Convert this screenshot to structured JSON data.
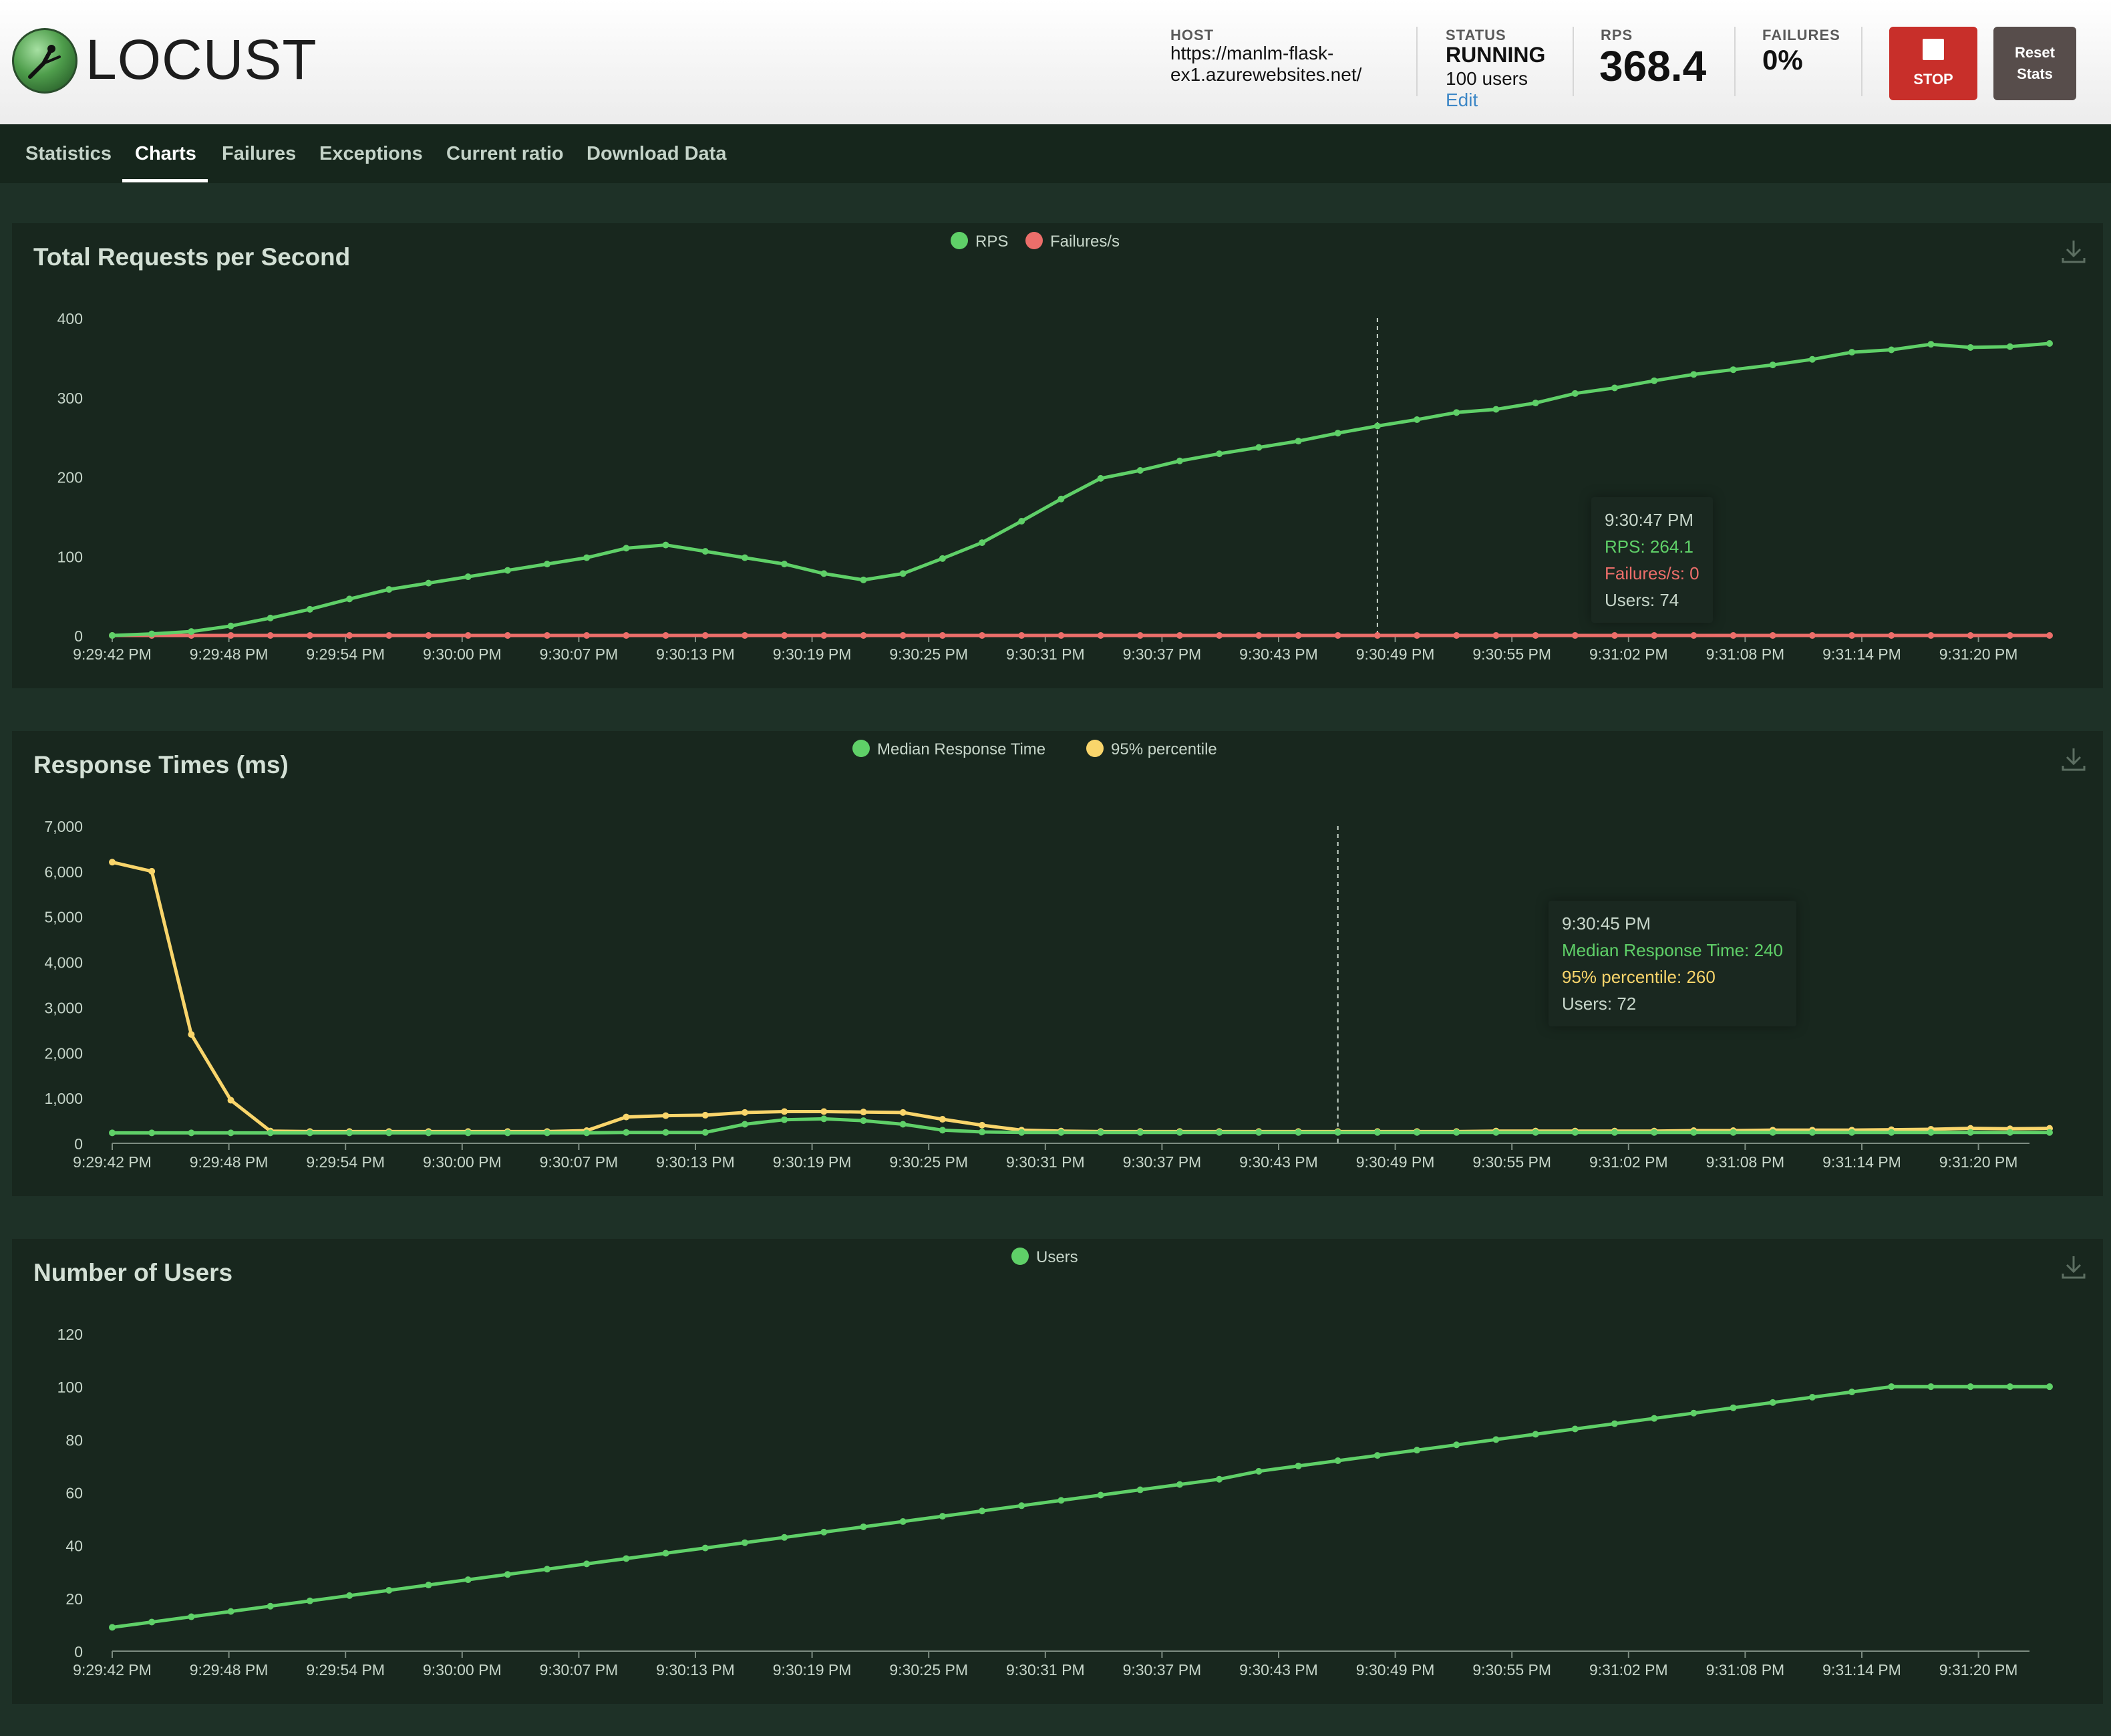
{
  "header": {
    "logo_text": "LOCUST",
    "host_label": "HOST",
    "host_line1": "https://manlm-flask-",
    "host_line2": "ex1.azurewebsites.net/",
    "status_label": "STATUS",
    "status_value": "RUNNING",
    "status_users": "100 users",
    "edit_label": "Edit",
    "rps_label": "RPS",
    "rps_value": "368.4",
    "failures_label": "FAILURES",
    "failures_value": "0%",
    "stop_label": "STOP",
    "reset_line1": "Reset",
    "reset_line2": "Stats"
  },
  "tabs": [
    "Statistics",
    "Charts",
    "Failures",
    "Exceptions",
    "Current ratio",
    "Download Data"
  ],
  "active_tab": "Charts",
  "colors": {
    "green": "#5fd068",
    "red": "#ec6e6a",
    "yellow": "#f9d56b",
    "panel": "#18271e",
    "axis_text": "#c7d6ca"
  },
  "charts": [
    {
      "id": "rps",
      "title": "Total Requests per Second",
      "legend": [
        {
          "name": "RPS",
          "color": "#5fd068"
        },
        {
          "name": "Failures/s",
          "color": "#ec6e6a"
        }
      ],
      "tooltip": {
        "time": "9:30:47 PM",
        "lines": [
          {
            "text": "RPS: 264.1",
            "color": "#5fd068"
          },
          {
            "text": "Failures/s: 0",
            "color": "#ec6e6a"
          },
          {
            "text": "Users: 74",
            "color": "#c7d6ca"
          }
        ]
      }
    },
    {
      "id": "response",
      "title": "Response Times (ms)",
      "legend": [
        {
          "name": "Median Response Time",
          "color": "#5fd068"
        },
        {
          "name": "95% percentile",
          "color": "#f9d56b"
        }
      ],
      "tooltip": {
        "time": "9:30:45 PM",
        "lines": [
          {
            "text": "Median Response Time: 240",
            "color": "#5fd068"
          },
          {
            "text": "95% percentile: 260",
            "color": "#f9d56b"
          },
          {
            "text": "Users: 72",
            "color": "#c7d6ca"
          }
        ]
      }
    },
    {
      "id": "users",
      "title": "Number of Users",
      "legend": [
        {
          "name": "Users",
          "color": "#5fd068"
        }
      ],
      "tooltip": null
    }
  ],
  "chart_data": [
    {
      "type": "line",
      "title": "Total Requests per Second",
      "x_ticks": [
        "9:29:42 PM",
        "9:29:48 PM",
        "9:29:54 PM",
        "9:30:00 PM",
        "9:30:07 PM",
        "9:30:13 PM",
        "9:30:19 PM",
        "9:30:25 PM",
        "9:30:31 PM",
        "9:30:37 PM",
        "9:30:43 PM",
        "9:30:49 PM",
        "9:30:55 PM",
        "9:31:02 PM",
        "9:31:08 PM",
        "9:31:14 PM",
        "9:31:20 PM"
      ],
      "y_ticks": [
        "0",
        "100",
        "200",
        "300",
        "400"
      ],
      "ylim": [
        0,
        400
      ],
      "n_points": 50,
      "hover_index": 32,
      "series": [
        {
          "name": "RPS",
          "color": "#5fd068",
          "values": [
            0,
            2,
            5,
            12,
            22,
            33,
            46,
            58,
            66,
            74,
            82,
            90,
            98,
            110,
            114,
            106,
            98,
            90,
            78,
            70,
            78,
            97,
            117,
            144,
            172,
            198,
            208,
            220,
            229,
            237,
            245,
            255,
            264,
            272,
            281,
            285,
            293,
            305,
            312,
            321,
            329,
            335,
            341,
            348,
            357,
            360,
            367,
            363,
            364,
            368
          ]
        },
        {
          "name": "Failures/s",
          "color": "#ec6e6a",
          "values": [
            0,
            0,
            0,
            0,
            0,
            0,
            0,
            0,
            0,
            0,
            0,
            0,
            0,
            0,
            0,
            0,
            0,
            0,
            0,
            0,
            0,
            0,
            0,
            0,
            0,
            0,
            0,
            0,
            0,
            0,
            0,
            0,
            0,
            0,
            0,
            0,
            0,
            0,
            0,
            0,
            0,
            0,
            0,
            0,
            0,
            0,
            0,
            0,
            0,
            0
          ]
        }
      ]
    },
    {
      "type": "line",
      "title": "Response Times (ms)",
      "x_ticks": [
        "9:29:42 PM",
        "9:29:48 PM",
        "9:29:54 PM",
        "9:30:00 PM",
        "9:30:07 PM",
        "9:30:13 PM",
        "9:30:19 PM",
        "9:30:25 PM",
        "9:30:31 PM",
        "9:30:37 PM",
        "9:30:43 PM",
        "9:30:49 PM",
        "9:30:55 PM",
        "9:31:02 PM",
        "9:31:08 PM",
        "9:31:14 PM",
        "9:31:20 PM"
      ],
      "y_ticks": [
        "0",
        "1,000",
        "2,000",
        "3,000",
        "4,000",
        "5,000",
        "6,000",
        "7,000"
      ],
      "ylim": [
        0,
        7000
      ],
      "n_points": 50,
      "hover_index": 31,
      "series": [
        {
          "name": "Median Response Time",
          "color": "#5fd068",
          "values": [
            230,
            230,
            230,
            230,
            230,
            230,
            230,
            230,
            230,
            230,
            230,
            230,
            230,
            240,
            240,
            240,
            420,
            520,
            540,
            500,
            420,
            290,
            250,
            240,
            240,
            240,
            240,
            240,
            240,
            240,
            240,
            240,
            240,
            240,
            240,
            240,
            240,
            240,
            240,
            240,
            240,
            240,
            240,
            240,
            240,
            240,
            240,
            240,
            240,
            240
          ]
        },
        {
          "name": "95% percentile",
          "color": "#f9d56b",
          "values": [
            6200,
            6000,
            2400,
            950,
            270,
            260,
            260,
            260,
            260,
            260,
            260,
            260,
            280,
            580,
            610,
            620,
            680,
            700,
            700,
            690,
            680,
            530,
            400,
            290,
            270,
            260,
            260,
            260,
            260,
            260,
            260,
            260,
            260,
            260,
            260,
            270,
            270,
            270,
            270,
            270,
            280,
            280,
            290,
            290,
            290,
            300,
            310,
            330,
            320,
            330
          ]
        }
      ]
    },
    {
      "type": "line",
      "title": "Number of Users",
      "x_ticks": [
        "9:29:42 PM",
        "9:29:48 PM",
        "9:29:54 PM",
        "9:30:00 PM",
        "9:30:07 PM",
        "9:30:13 PM",
        "9:30:19 PM",
        "9:30:25 PM",
        "9:30:31 PM",
        "9:30:37 PM",
        "9:30:43 PM",
        "9:30:49 PM",
        "9:30:55 PM",
        "9:31:02 PM",
        "9:31:08 PM",
        "9:31:14 PM",
        "9:31:20 PM"
      ],
      "y_ticks": [
        "0",
        "20",
        "40",
        "60",
        "80",
        "100",
        "120"
      ],
      "ylim": [
        0,
        120
      ],
      "n_points": 50,
      "hover_index": null,
      "series": [
        {
          "name": "Users",
          "color": "#5fd068",
          "values": [
            9,
            11,
            13,
            15,
            17,
            19,
            21,
            23,
            25,
            27,
            29,
            31,
            33,
            35,
            37,
            39,
            41,
            43,
            45,
            47,
            49,
            51,
            53,
            55,
            57,
            59,
            61,
            63,
            65,
            68,
            70,
            72,
            74,
            76,
            78,
            80,
            82,
            84,
            86,
            88,
            90,
            92,
            94,
            96,
            98,
            100,
            100,
            100,
            100,
            100
          ]
        }
      ]
    }
  ]
}
